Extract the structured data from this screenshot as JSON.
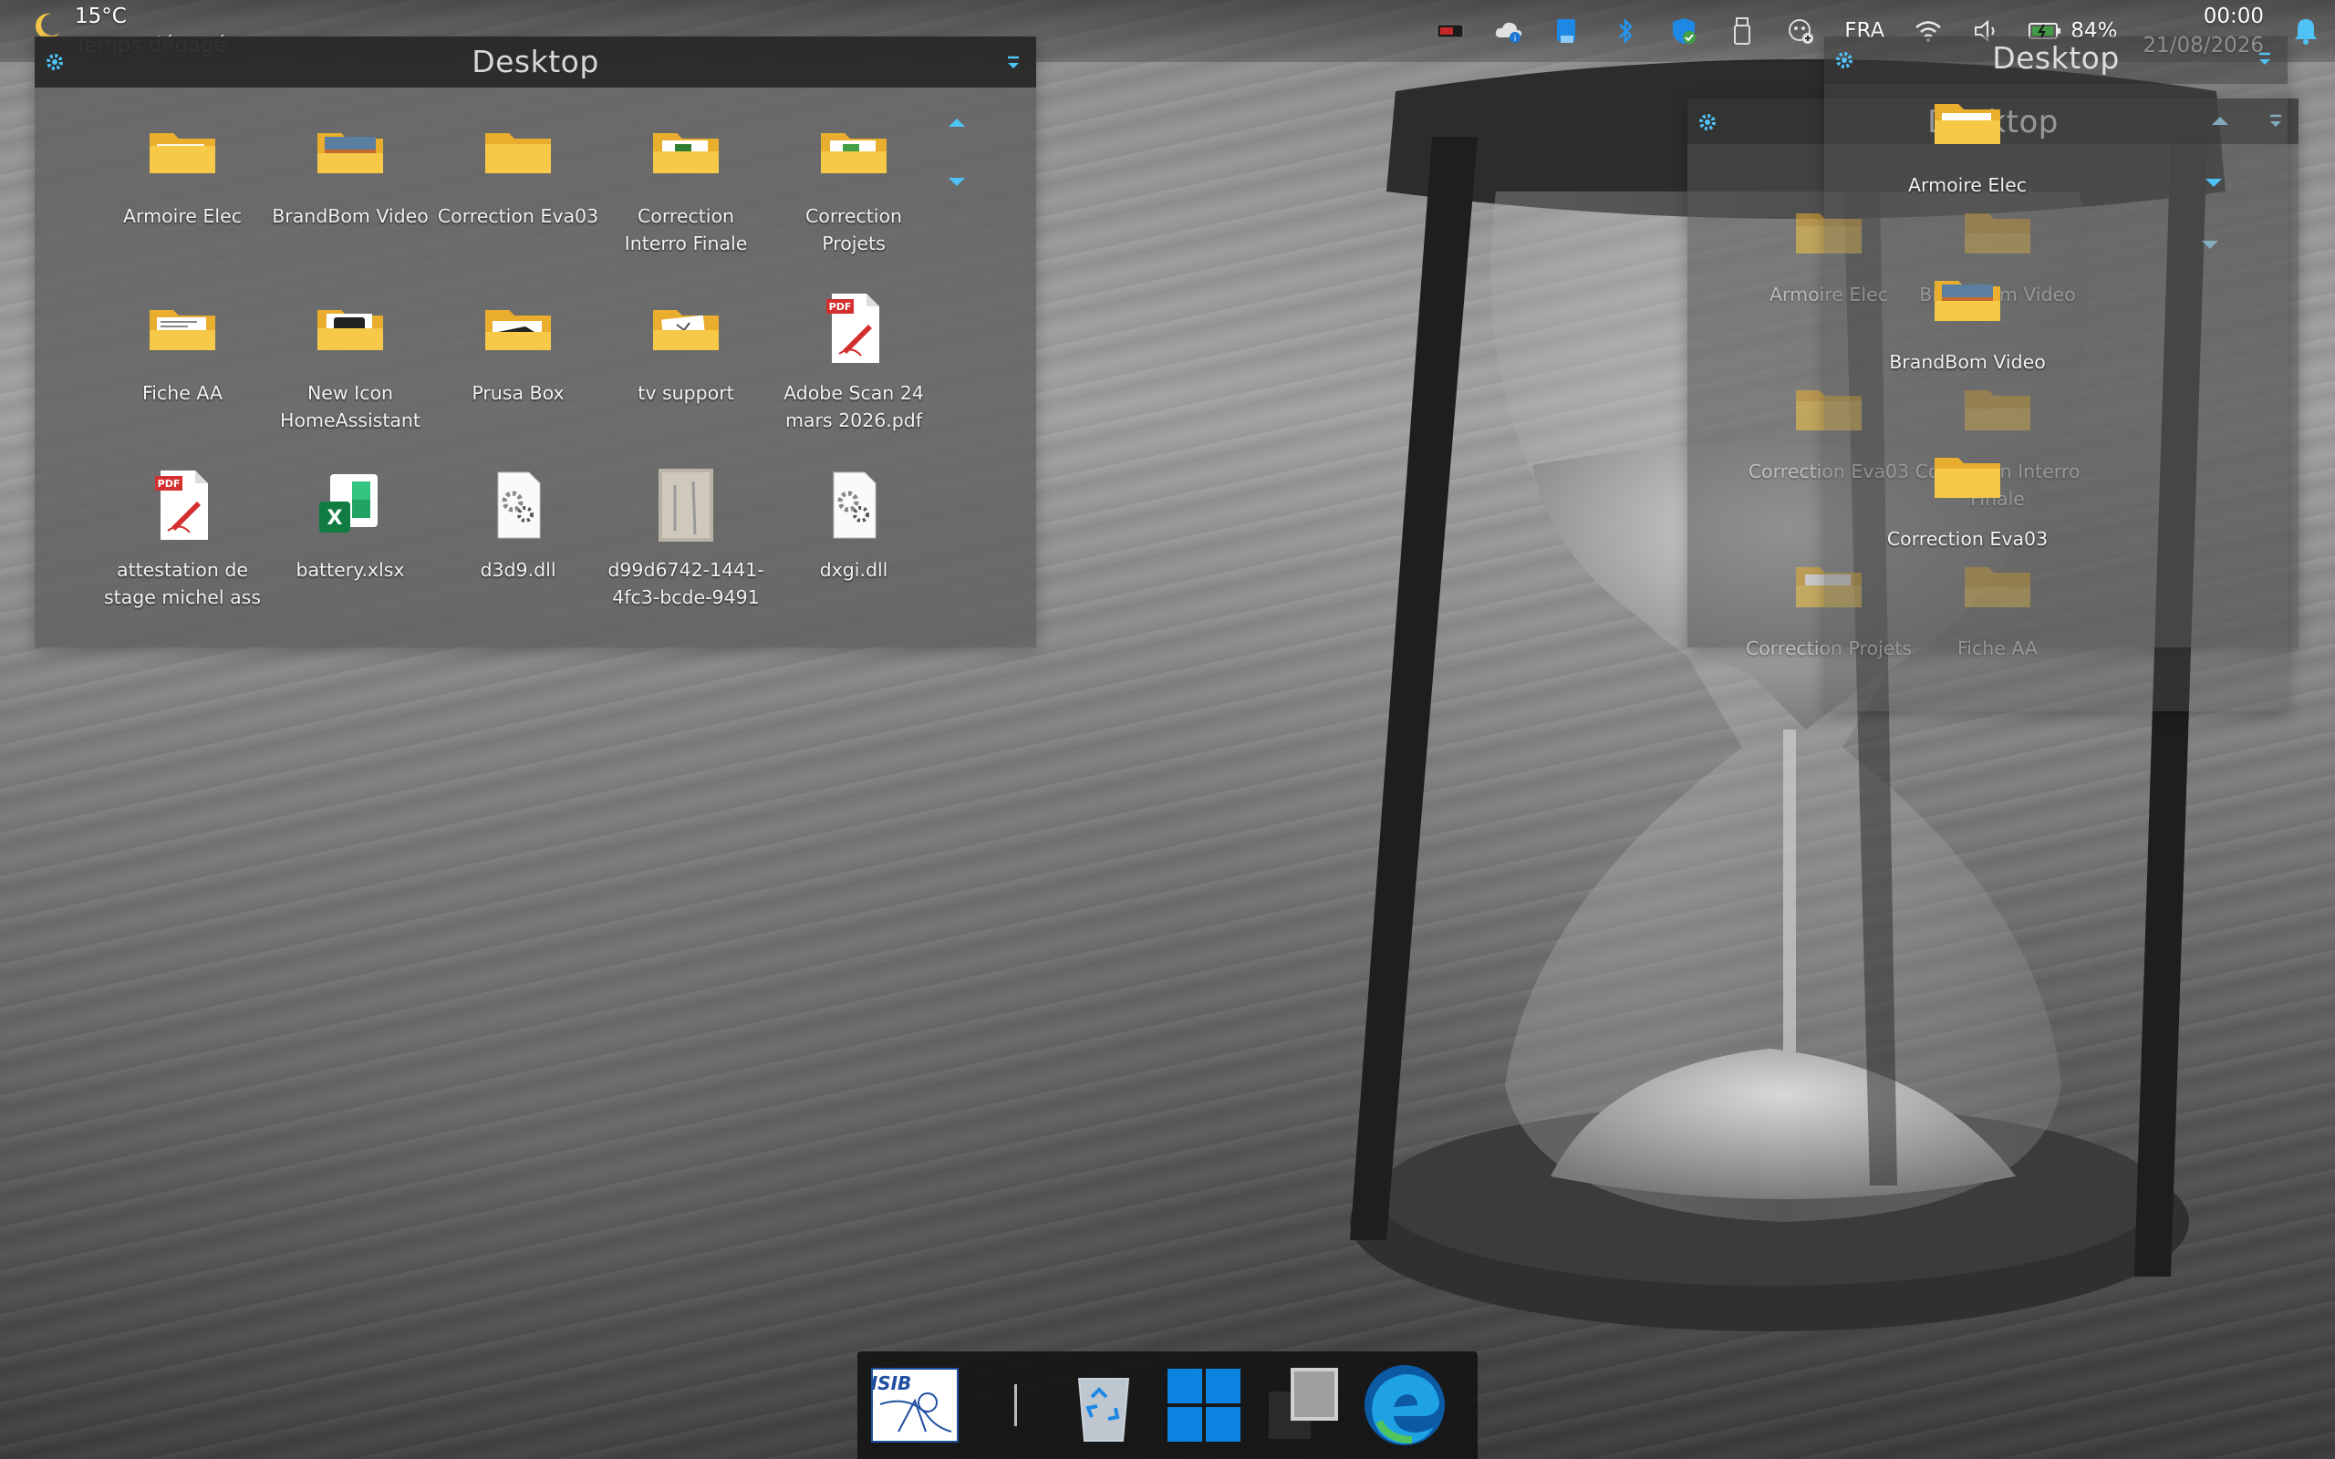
{
  "weather": {
    "temp": "15°C",
    "condition": "Temps dégagé",
    "icon": "moon-icon"
  },
  "tray": {
    "language": "FRA",
    "battery": "84%",
    "time": "00:00",
    "date": "21/08/2026",
    "icons": [
      "red-card-icon",
      "onedrive-icon",
      "blue-app-icon",
      "bluetooth-icon",
      "defender-icon",
      "usb-drive-icon",
      "meet-now-icon",
      "wifi-icon",
      "volume-icon",
      "battery-icon",
      "bell-icon"
    ]
  },
  "fence_main": {
    "title": "Desktop",
    "items": [
      {
        "label": "Armoire Elec",
        "icon": "folder-icon"
      },
      {
        "label": "BrandBom Video",
        "icon": "folder-image-icon"
      },
      {
        "label": "Correction Eva03",
        "icon": "folder-icon"
      },
      {
        "label": "Correction Interro Finale",
        "icon": "folder-doc-icon"
      },
      {
        "label": "Correction Projets",
        "icon": "folder-doc-icon"
      },
      {
        "label": "Fiche AA",
        "icon": "folder-doc-icon"
      },
      {
        "label": "New Icon HomeAssistant",
        "icon": "folder-printer-icon"
      },
      {
        "label": "Prusa Box",
        "icon": "folder-icon"
      },
      {
        "label": "tv support",
        "icon": "folder-doc-icon"
      },
      {
        "label": "Adobe Scan 24 mars 2026.pdf",
        "icon": "pdf-icon"
      },
      {
        "label": "attestation de stage michel ass",
        "icon": "pdf-icon"
      },
      {
        "label": "battery.xlsx",
        "icon": "excel-icon"
      },
      {
        "label": "d3d9.dll",
        "icon": "dll-icon"
      },
      {
        "label": "d99d6742-1441-4fc3-bcde-9491",
        "icon": "image-thumb-icon"
      },
      {
        "label": "dxgi.dll",
        "icon": "dll-icon"
      }
    ]
  },
  "fence_right_back": {
    "title": "Desktop",
    "items": [
      {
        "label": "Armoire Elec"
      },
      {
        "label": "BrandBom Video"
      },
      {
        "label": "Correction Eva03"
      },
      {
        "label": "Correction Interro Finale"
      },
      {
        "label": "Correction Projets"
      },
      {
        "label": "Fiche AA"
      }
    ]
  },
  "fence_right_front": {
    "title": "Desktop",
    "items": [
      {
        "label": "Armoire Elec"
      },
      {
        "label": "BrandBom Video"
      },
      {
        "label": "Correction Eva03"
      }
    ]
  },
  "taskbar": {
    "items": [
      "isib-logo-icon",
      "recycle-bin-icon",
      "windows-start-icon",
      "task-view-icon",
      "edge-icon"
    ],
    "isib_text": "ISIB"
  },
  "colors": {
    "accent": "#4fc3f7",
    "folder": "#f7c948"
  }
}
